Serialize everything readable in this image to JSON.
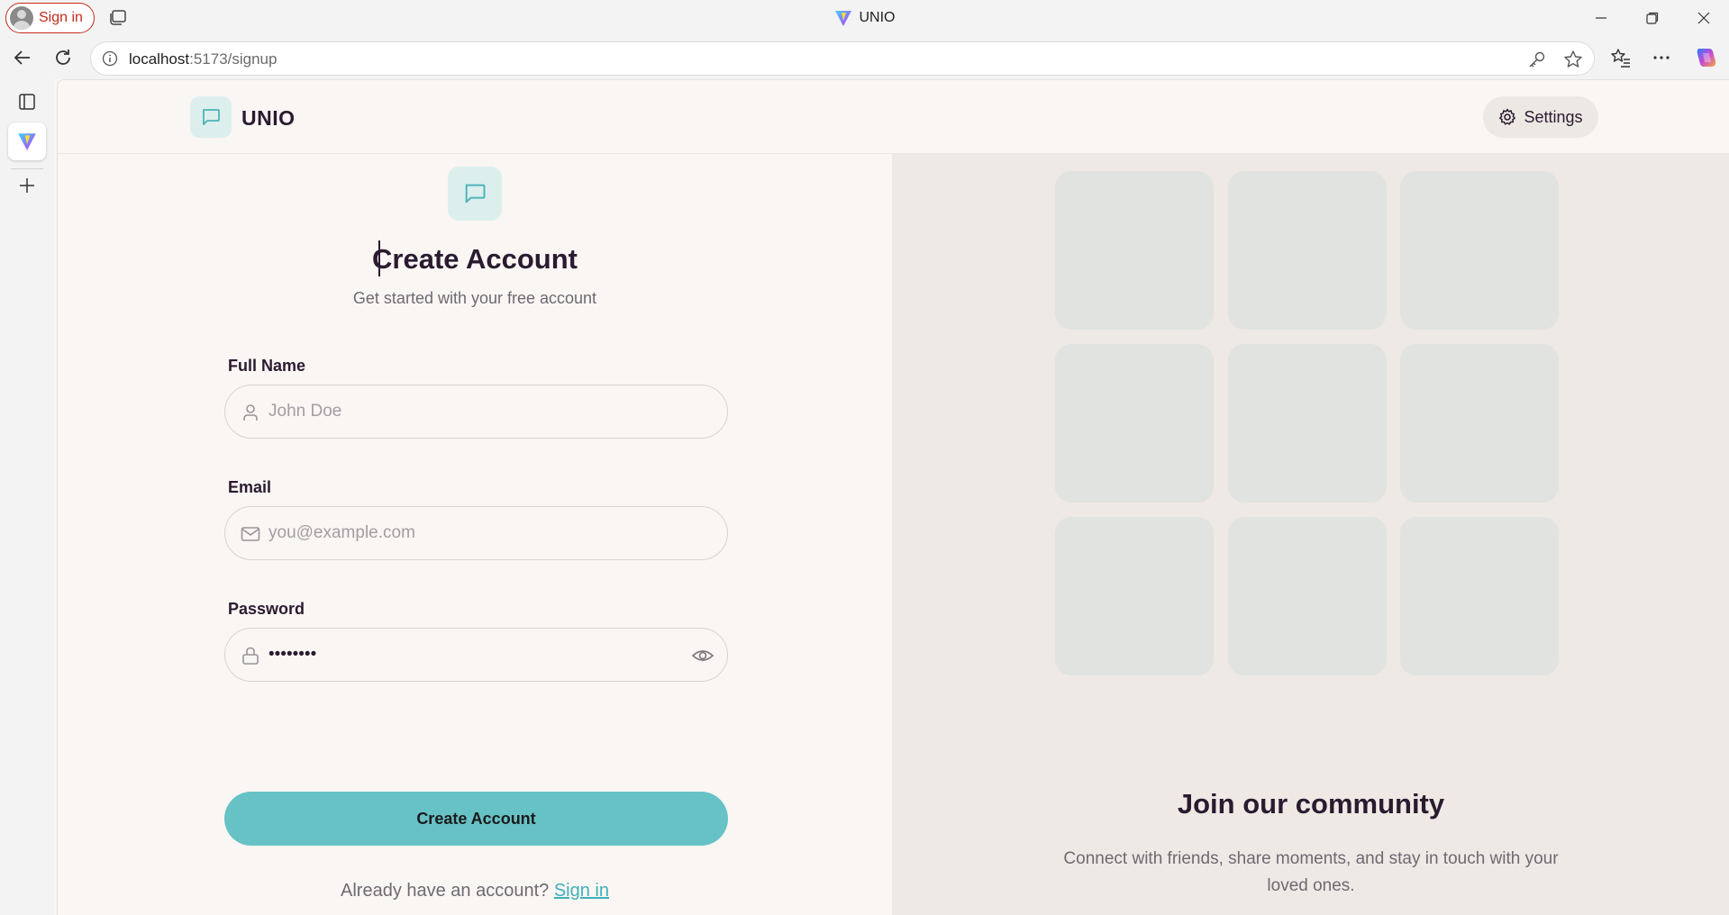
{
  "browser": {
    "signin_label": "Sign in",
    "window_title": "UNIO",
    "url_host": "localhost",
    "url_path": ":5173/signup",
    "icons": [
      "profile-avatar-icon",
      "tabs-icon",
      "vite-logo-icon",
      "minimize-icon",
      "restore-icon",
      "close-icon",
      "back-icon",
      "refresh-icon",
      "info-icon",
      "key-icon",
      "star-icon",
      "favorites-icon",
      "more-icon",
      "copilot-icon",
      "sidebar-tabs-icon",
      "add-icon"
    ]
  },
  "header": {
    "brand_name": "UNIO",
    "settings_label": "Settings"
  },
  "form": {
    "title": "Create Account",
    "subtitle": "Get started with your free account",
    "full_name": {
      "label": "Full Name",
      "placeholder": "John Doe"
    },
    "email": {
      "label": "Email",
      "placeholder": "you@example.com"
    },
    "password": {
      "label": "Password",
      "value": "12345678"
    },
    "submit_label": "Create Account",
    "already_text": "Already have an account?",
    "signin_link": "Sign in"
  },
  "community": {
    "title": "Join our community",
    "description": "Connect with friends, share moments, and stay in touch with your loved ones."
  },
  "colors": {
    "accent": "#67c2c6",
    "link": "#3eb1b7",
    "heading": "#2a1b30",
    "tile": "#e0e3df",
    "page_bg": "#faf6f3",
    "right_pane_bg": "#eee9e5"
  }
}
